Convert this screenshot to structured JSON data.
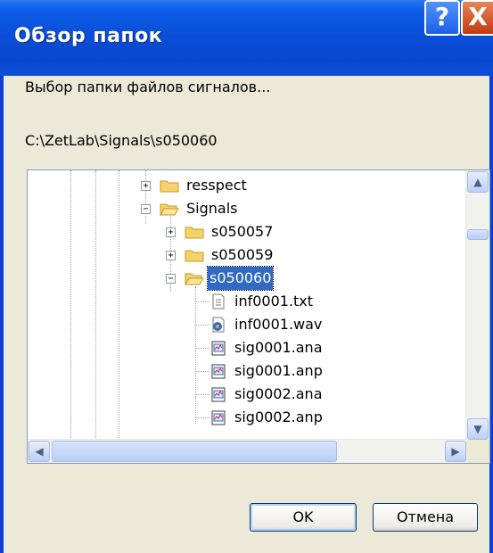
{
  "dialog": {
    "title": "Обзор папок",
    "help_glyph": "?",
    "close_glyph": "X",
    "description": "Выбор папки файлов сигналов...",
    "path": "C:\\ZetLab\\Signals\\s050060"
  },
  "tree": {
    "items": [
      {
        "label": "resspect",
        "kind": "folder",
        "expander": "+"
      },
      {
        "label": "Signals",
        "kind": "folder-open",
        "expander": "−"
      },
      {
        "label": "s050057",
        "kind": "folder",
        "expander": "+"
      },
      {
        "label": "s050059",
        "kind": "folder",
        "expander": "+"
      },
      {
        "label": "s050060",
        "kind": "folder-open",
        "expander": "−",
        "selected": true
      },
      {
        "label": "inf0001.txt",
        "kind": "text-file"
      },
      {
        "label": "inf0001.wav",
        "kind": "media-file"
      },
      {
        "label": "sig0001.ana",
        "kind": "signal-file"
      },
      {
        "label": "sig0001.anp",
        "kind": "signal-file"
      },
      {
        "label": "sig0002.ana",
        "kind": "signal-file"
      },
      {
        "label": "sig0002.anp",
        "kind": "signal-file"
      }
    ],
    "scroll_up_glyph": "▲",
    "scroll_down_glyph": "▼",
    "scroll_left_glyph": "◀",
    "scroll_right_glyph": "▶"
  },
  "buttons": {
    "ok_label": "OK",
    "cancel_label": "Отмена"
  },
  "colors": {
    "titlebar": "#0a4fd8",
    "selection": "#316ac5",
    "dialog_bg": "#ece9d8"
  }
}
